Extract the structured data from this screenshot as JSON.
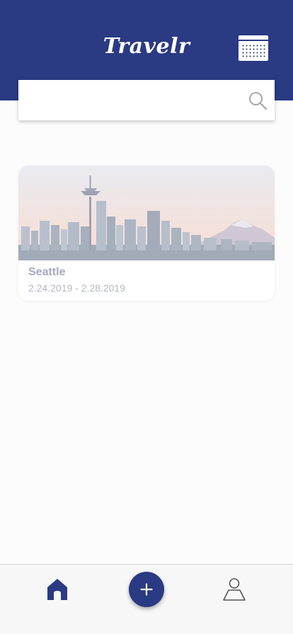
{
  "app": {
    "title": "Travelr",
    "accent_color": "#2a3a83"
  },
  "header": {
    "calendar_icon": "calendar-icon"
  },
  "search": {
    "value": "",
    "placeholder": "",
    "icon": "search-icon"
  },
  "trips": [
    {
      "title": "Seattle",
      "dates": "2.24.2019 - 2.28.2019",
      "image": "seattle-skyline"
    }
  ],
  "bottom_nav": {
    "items": [
      {
        "icon": "home-icon",
        "active": true
      },
      {
        "icon": "plus-icon"
      },
      {
        "icon": "user-icon"
      }
    ]
  }
}
